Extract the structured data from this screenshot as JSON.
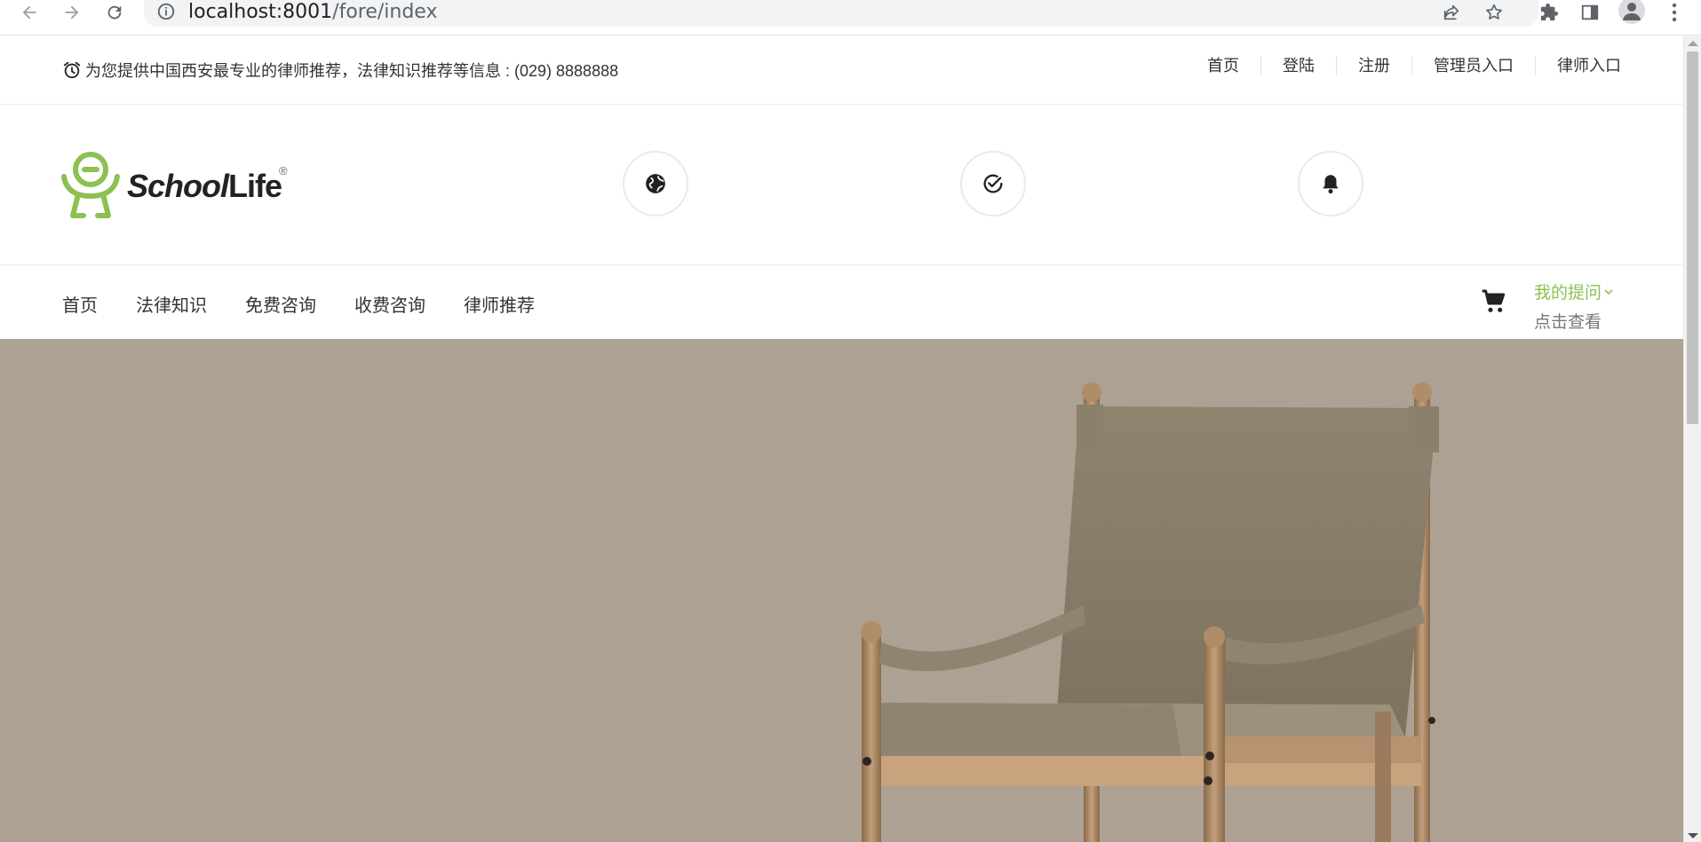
{
  "browser": {
    "url_host": "localhost:8001",
    "url_path": "/fore/index"
  },
  "topbar": {
    "notice": "为您提供中国西安最专业的律师推荐，法律知识推荐等信息 : (029) 8888888",
    "links": [
      "首页",
      "登陆",
      "注册",
      "管理员入口",
      "律师入口"
    ]
  },
  "header": {
    "logo_part1": "School",
    "logo_part2": "Life",
    "logo_reg": "®"
  },
  "mainnav": {
    "items": [
      "首页",
      "法律知识",
      "免费咨询",
      "收费咨询",
      "律师推荐"
    ],
    "my_questions": "我的提问",
    "view": "点击查看"
  },
  "colors": {
    "accent": "#8cc152",
    "hero_bg": "#ada193"
  }
}
